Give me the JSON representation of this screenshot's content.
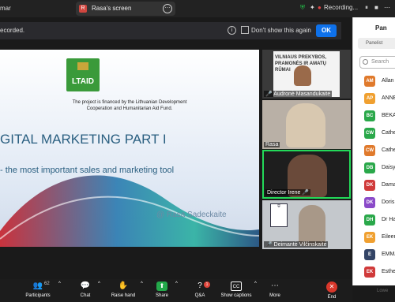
{
  "topbar": {
    "left_text": "mar",
    "share_tab_letter": "R",
    "share_tab_label": "Rasa's screen",
    "share_tab_more": "⋯",
    "recording_label": "Recording...",
    "controls": [
      "⏸",
      "■",
      "⋯"
    ]
  },
  "banner": {
    "message": "ecorded.",
    "info_icon": "i",
    "dont_show_label": "Don't show this again",
    "ok_label": "OK"
  },
  "slide": {
    "logo_text": "LTAID",
    "financed_line1": "The project is financed by the Lithuanian Development",
    "financed_line2": "Cooperation and Humanitarian Aid Fund.",
    "title": "GITAL MARKETING PART I",
    "subtitle": "- the most important sales and marketing tool",
    "author": "@ Rasa Sadeckaite"
  },
  "videos": [
    {
      "name": "Audronė Masandukaitė",
      "muted": true,
      "bg_text": "VILNIAUS PREKYBOS, PRAMONĖS IR AMATŲ RŪMAI"
    },
    {
      "name": "Rasa",
      "muted": false
    },
    {
      "name": "Director Irene",
      "muted": true
    },
    {
      "name": "Deimantė Vilčinskaitė",
      "muted": true
    }
  ],
  "panel": {
    "title": "Pan",
    "tab_label": "Panelist",
    "search_placeholder": "Search",
    "people": [
      {
        "initials": "AM",
        "name": "Allan M",
        "color": "#e07a2c"
      },
      {
        "initials": "AP",
        "name": "ANNE",
        "color": "#f0a030"
      },
      {
        "initials": "BC",
        "name": "BEKAF",
        "color": "#2aa84a"
      },
      {
        "initials": "CW",
        "name": "Cather",
        "color": "#2aa84a"
      },
      {
        "initials": "CW",
        "name": "Cathe",
        "color": "#e07a2c"
      },
      {
        "initials": "DB",
        "name": "Daisy",
        "color": "#2aa84a"
      },
      {
        "initials": "DK",
        "name": "Dama",
        "color": "#d03a3a"
      },
      {
        "initials": "DK",
        "name": "Doris",
        "color": "#8a4ac8"
      },
      {
        "initials": "DH",
        "name": "Dr Ha",
        "color": "#2aa84a"
      },
      {
        "initials": "EK",
        "name": "Eileen",
        "color": "#f0a030"
      },
      {
        "initials": "E",
        "name": "EMMA",
        "color": "#334466"
      },
      {
        "initials": "EK",
        "name": "Esther",
        "color": "#d03a3a"
      }
    ],
    "bottom_text": "Lowe"
  },
  "toolbar": {
    "participants_count": "62",
    "items": [
      {
        "label": "Participants",
        "icon": "👥"
      },
      {
        "label": "Chat",
        "icon": "💬"
      },
      {
        "label": "Raise hand",
        "icon": "✋"
      },
      {
        "label": "Share",
        "icon": "⬆"
      },
      {
        "label": "Q&A",
        "icon": "?"
      },
      {
        "label": "Show captions",
        "icon": "CC"
      },
      {
        "label": "More",
        "icon": "⋯"
      },
      {
        "label": "End",
        "icon": "✕"
      }
    ],
    "qa_badge": "1"
  }
}
